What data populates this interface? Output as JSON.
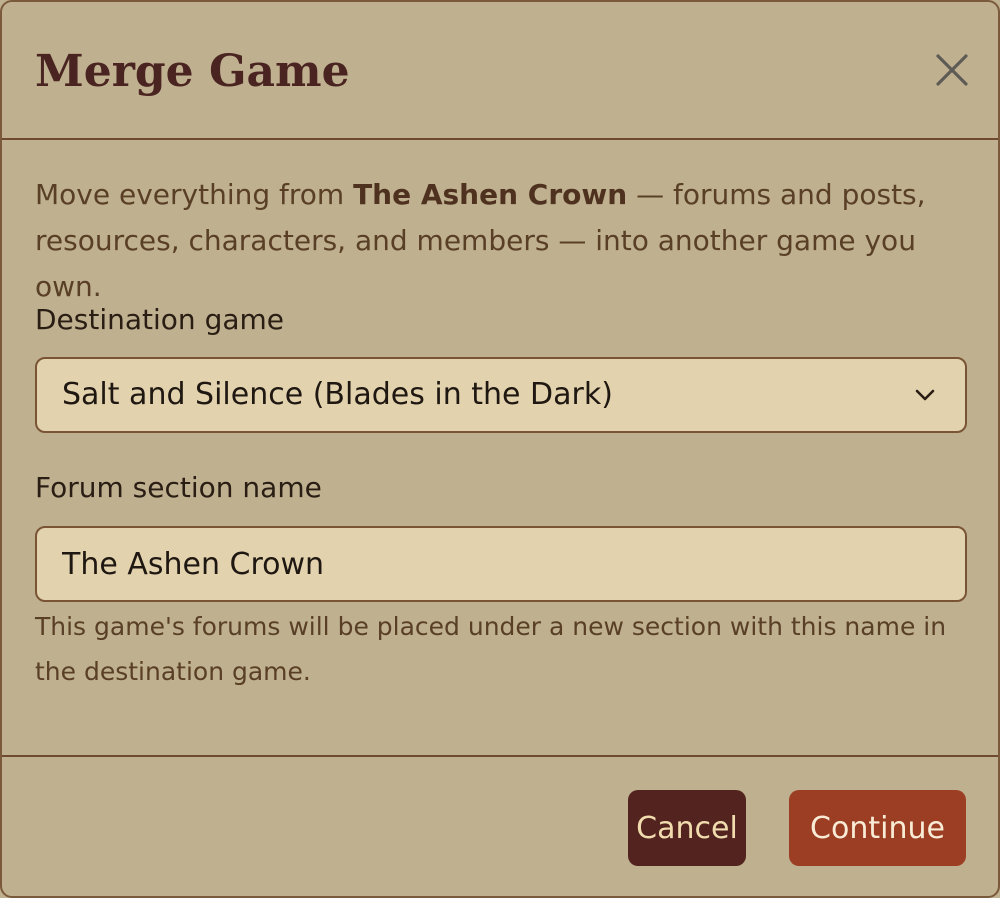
{
  "dialog": {
    "title": "Merge Game",
    "close_icon": "close-icon"
  },
  "intro": {
    "before": "Move everything from ",
    "game_name": "The Ashen Crown",
    "after": " — forums and posts, resources, characters, and members — into another game you own."
  },
  "destination": {
    "label": "Destination game",
    "selected": "Salt and Silence (Blades in the Dark)",
    "icon": "chevron-down-icon"
  },
  "section_name": {
    "label": "Forum section name",
    "value": "The Ashen Crown",
    "help": "This game's forums will be placed under a new section with this name in the destination game."
  },
  "footer": {
    "cancel_label": "Cancel",
    "continue_label": "Continue"
  },
  "colors": {
    "background": "#bfb08f",
    "title": "#4a2421",
    "input_background": "#e2d2ad",
    "cancel_button": "#532320",
    "continue_button": "#9c3e23"
  }
}
